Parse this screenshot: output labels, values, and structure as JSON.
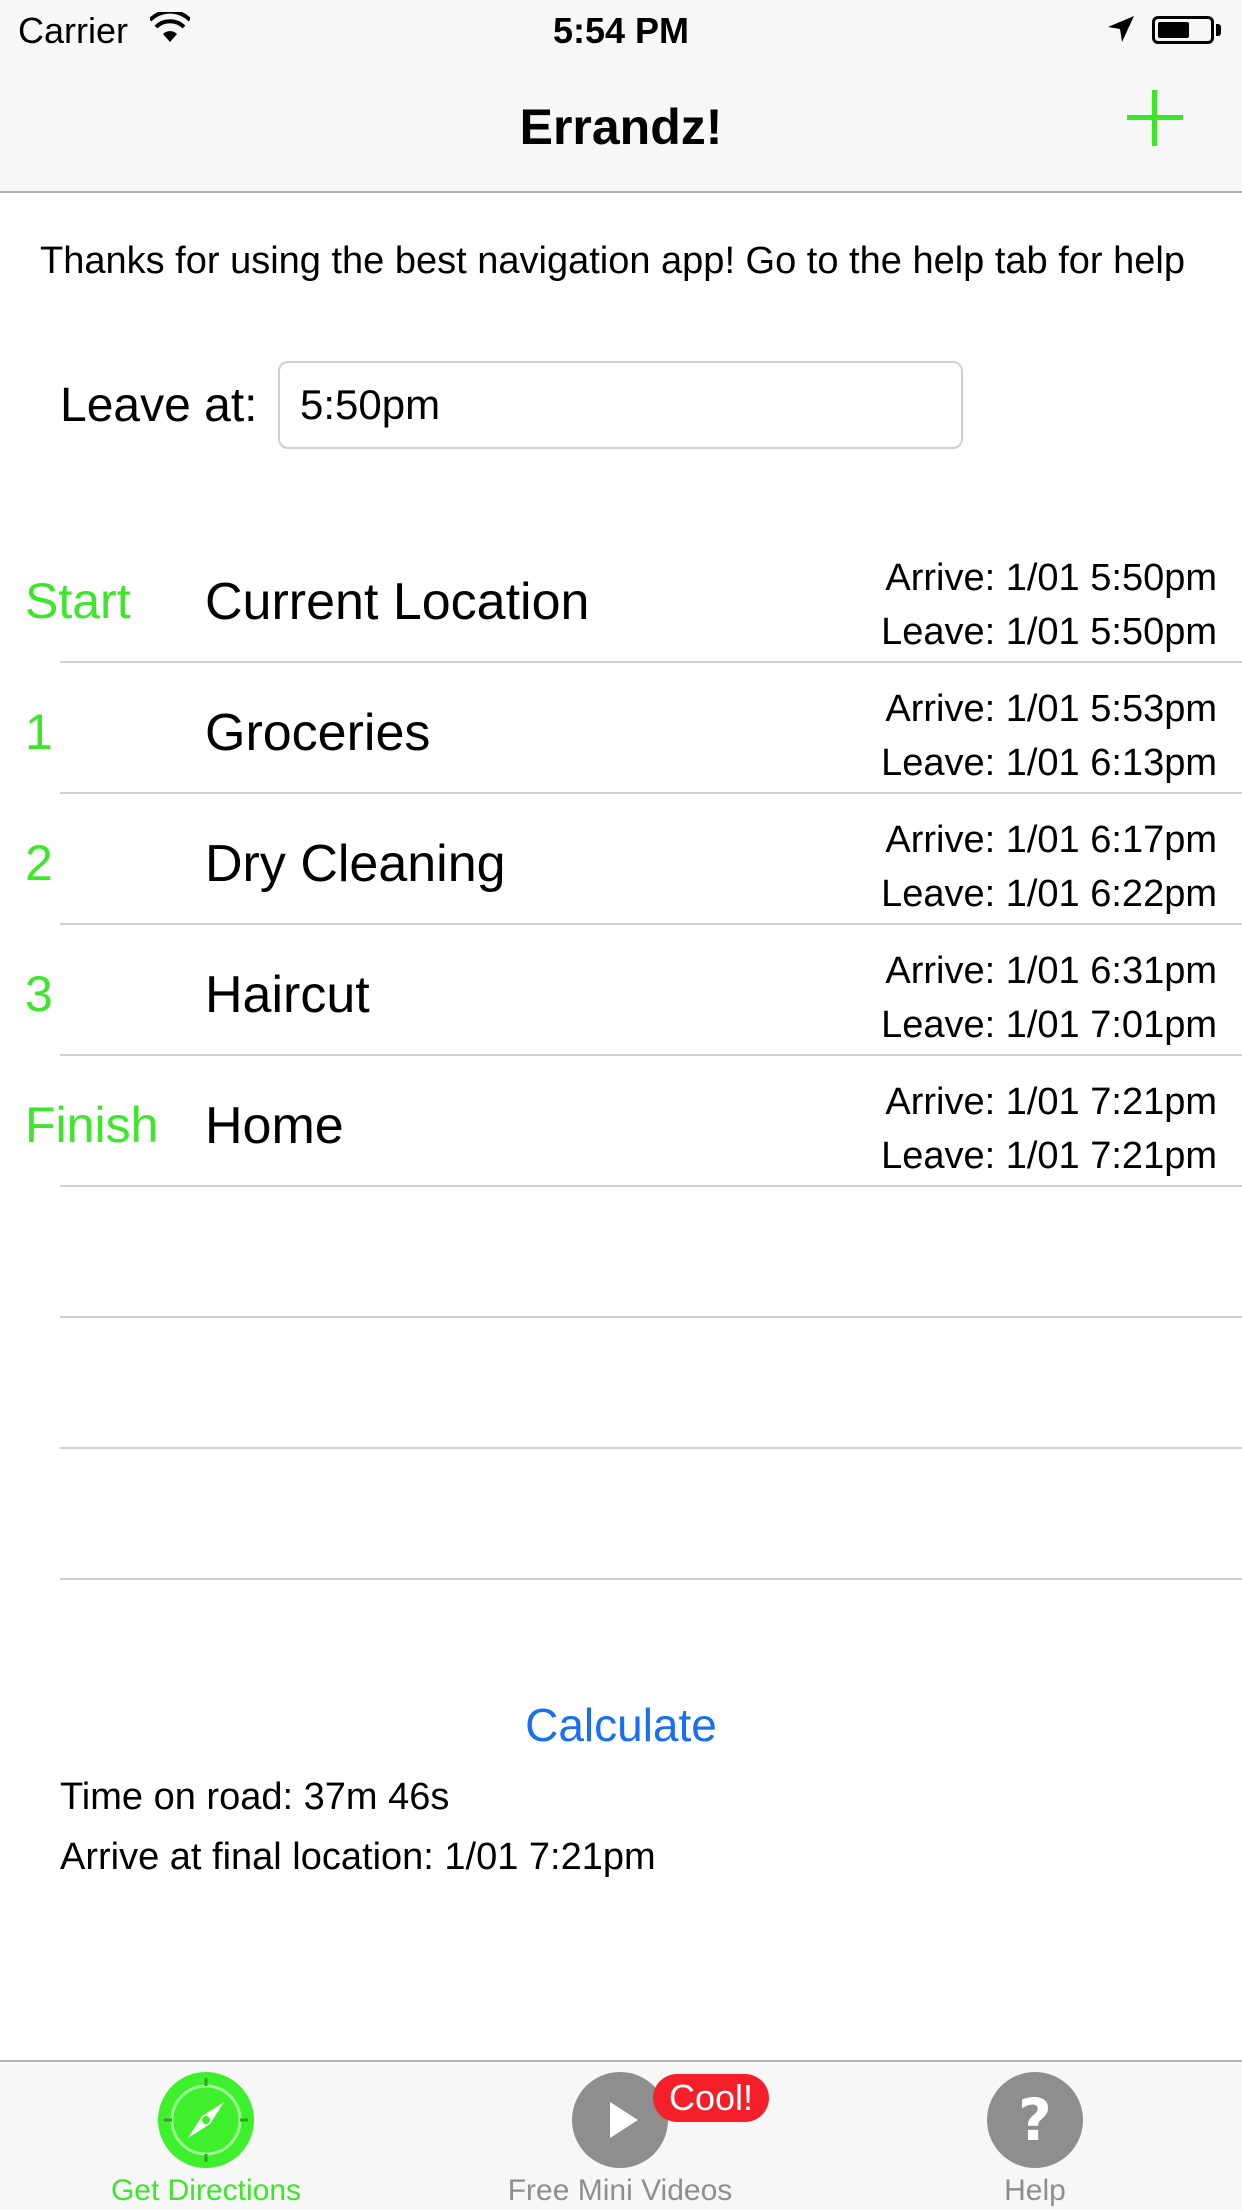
{
  "status_bar": {
    "carrier": "Carrier",
    "time": "5:54 PM",
    "wifi_icon": "wifi-icon",
    "location_icon": "location-arrow-icon",
    "battery_icon": "battery-icon"
  },
  "nav": {
    "title": "Errandz!",
    "add_icon": "plus-icon"
  },
  "intro": "Thanks for using the best navigation app! Go to the help tab for help",
  "leave": {
    "label": "Leave at:",
    "value": "5:50pm"
  },
  "stops": [
    {
      "label": "Start",
      "name": "Current Location",
      "arrive": "Arrive: 1/01 5:50pm",
      "leave": "Leave: 1/01 5:50pm"
    },
    {
      "label": "1",
      "name": "Groceries",
      "arrive": "Arrive: 1/01 5:53pm",
      "leave": "Leave: 1/01 6:13pm"
    },
    {
      "label": "2",
      "name": "Dry Cleaning",
      "arrive": "Arrive: 1/01 6:17pm",
      "leave": "Leave: 1/01 6:22pm"
    },
    {
      "label": "3",
      "name": "Haircut",
      "arrive": "Arrive: 1/01 6:31pm",
      "leave": "Leave: 1/01 7:01pm"
    },
    {
      "label": "Finish",
      "name": "Home",
      "arrive": "Arrive: 1/01 7:21pm",
      "leave": "Leave: 1/01 7:21pm"
    }
  ],
  "calculate_label": "Calculate",
  "summary": {
    "road_time": "Time on road: 37m 46s",
    "final_arrival": "Arrive at final location: 1/01 7:21pm"
  },
  "tabs": [
    {
      "label": "Get Directions",
      "icon": "compass-icon",
      "selected": true
    },
    {
      "label": "Free Mini Videos",
      "icon": "play-icon",
      "badge": "Cool!"
    },
    {
      "label": "Help",
      "icon": "question-mark-icon"
    }
  ],
  "colors": {
    "accent_green": "#3ee62b",
    "link_blue": "#1a6ff0",
    "badge_red": "#f41f29",
    "inactive_gray": "#8e8e8e"
  }
}
